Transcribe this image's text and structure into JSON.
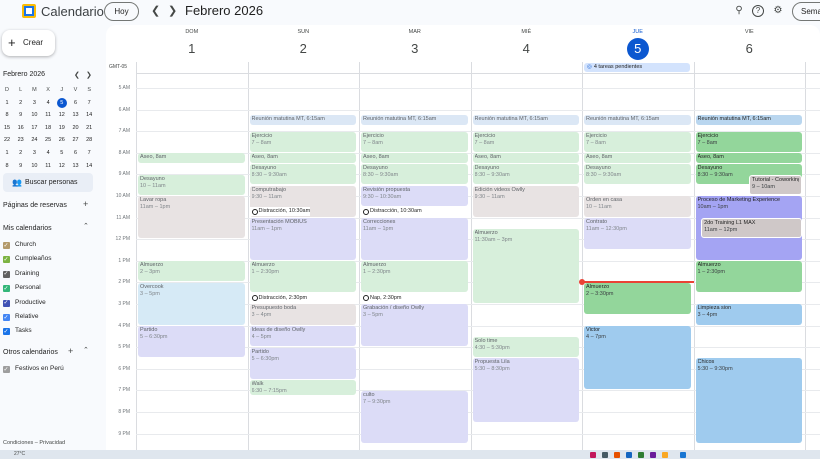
{
  "app": {
    "title": "Calendario",
    "period": "Febrero 2026",
    "today_label": "Hoy",
    "view_label": "Semana"
  },
  "sidebar": {
    "create_label": "Crear",
    "mini_month": "Febrero 2026",
    "mini_headers": [
      "D",
      "L",
      "M",
      "X",
      "J",
      "V",
      "S"
    ],
    "mini_weeks": [
      [
        "1",
        "2",
        "3",
        "4",
        "5",
        "6",
        "7"
      ],
      [
        "8",
        "9",
        "10",
        "11",
        "12",
        "13",
        "14"
      ],
      [
        "15",
        "16",
        "17",
        "18",
        "19",
        "20",
        "21"
      ],
      [
        "22",
        "23",
        "24",
        "25",
        "26",
        "27",
        "28"
      ],
      [
        "1",
        "2",
        "3",
        "4",
        "5",
        "6",
        "7"
      ],
      [
        "8",
        "9",
        "10",
        "11",
        "12",
        "13",
        "14"
      ]
    ],
    "search_people": "Buscar personas",
    "booking_pages": "Páginas de reservas",
    "my_calendars": "Mis calendarios",
    "calendars": [
      {
        "label": "Church",
        "color": "#b39a6b"
      },
      {
        "label": "Cumpleaños",
        "color": "#7cb342"
      },
      {
        "label": "Draining",
        "color": "#616161"
      },
      {
        "label": "Personal",
        "color": "#33b679"
      },
      {
        "label": "Productive",
        "color": "#3f51b5"
      },
      {
        "label": "Relative",
        "color": "#4285f4"
      },
      {
        "label": "Tasks",
        "color": "#1a73e8"
      }
    ],
    "other_calendars": "Otros calendarios",
    "other_list": [
      {
        "label": "Festivos en Perú",
        "color": "#9e9e9e"
      }
    ],
    "footer": "Condiciones – Privacidad"
  },
  "week": {
    "timezone": "GMT-05",
    "days": [
      {
        "name": "DOM",
        "num": "1"
      },
      {
        "name": "SUN",
        "num": "2"
      },
      {
        "name": "MAR",
        "num": "3"
      },
      {
        "name": "MIÉ",
        "num": "4"
      },
      {
        "name": "JUE",
        "num": "5",
        "today": true
      },
      {
        "name": "VIE",
        "num": "6"
      }
    ],
    "hours": [
      "5 AM",
      "6 AM",
      "7 AM",
      "8 AM",
      "9 AM",
      "10 AM",
      "11 AM",
      "12 PM",
      "1 PM",
      "2 PM",
      "3 PM",
      "4 PM",
      "5 PM",
      "6 PM",
      "7 PM",
      "8 PM",
      "9 PM"
    ],
    "allday": [
      {
        "day": 4,
        "text": "4 tareas pendientes"
      }
    ],
    "events": [
      {
        "day": 0,
        "start": 8.0,
        "end": 8.5,
        "title": "Aseo, 8am",
        "sub": "",
        "style": "green"
      },
      {
        "day": 0,
        "start": 9.0,
        "end": 10.0,
        "title": "Desayuno",
        "sub": "10 – 11am",
        "style": "green"
      },
      {
        "day": 0,
        "start": 10.0,
        "end": 12.0,
        "title": "Lavar ropa",
        "sub": "11am – 1pm",
        "style": "gray"
      },
      {
        "day": 0,
        "start": 13.0,
        "end": 14.0,
        "title": "Almuerzo",
        "sub": "2 – 3pm",
        "style": "green"
      },
      {
        "day": 0,
        "start": 14.0,
        "end": 16.0,
        "title": "Overcook",
        "sub": "3 – 5pm",
        "style": "lblue"
      },
      {
        "day": 0,
        "start": 16.0,
        "end": 17.5,
        "title": "Partido",
        "sub": "5 – 6:30pm",
        "style": "purple"
      },
      {
        "day": 1,
        "start": 6.25,
        "end": 6.75,
        "title": "Reunión matutina MT, 6:15am",
        "sub": "",
        "style": "blue"
      },
      {
        "day": 1,
        "start": 7.0,
        "end": 8.0,
        "title": "Ejercicio",
        "sub": "7 – 8am",
        "style": "green"
      },
      {
        "day": 1,
        "start": 8.0,
        "end": 8.5,
        "title": "Aseo, 8am",
        "sub": "",
        "style": "green"
      },
      {
        "day": 1,
        "start": 8.5,
        "end": 9.5,
        "title": "Desayuno",
        "sub": "8:30 – 9:30am",
        "style": "green"
      },
      {
        "day": 1,
        "start": 9.5,
        "end": 11.0,
        "title": "Computrabajo",
        "sub": "9:30 – 11am",
        "style": "gray"
      },
      {
        "day": 1,
        "start": 11.0,
        "end": 13.0,
        "title": "Presentación MOBIUS",
        "sub": "11am – 1pm",
        "style": "purple"
      },
      {
        "day": 1,
        "start": 13.0,
        "end": 14.5,
        "title": "Almuerzo",
        "sub": "1 – 2:30pm",
        "style": "green"
      },
      {
        "day": 1,
        "start": 15.0,
        "end": 16.0,
        "title": "Presupuesto boda",
        "sub": "3 – 4pm",
        "style": "gray"
      },
      {
        "day": 1,
        "start": 16.0,
        "end": 17.0,
        "title": "Ideas de diseño Owlly",
        "sub": "4 – 5pm",
        "style": "purple"
      },
      {
        "day": 1,
        "start": 17.0,
        "end": 18.5,
        "title": "Partido",
        "sub": "5 – 6:30pm",
        "style": "purple"
      },
      {
        "day": 1,
        "start": 18.5,
        "end": 19.25,
        "title": "Walk",
        "sub": "6:30 – 7:15pm",
        "style": "green"
      },
      {
        "day": 2,
        "start": 6.25,
        "end": 6.75,
        "title": "Reunión matutina MT, 6:15am",
        "sub": "",
        "style": "blue"
      },
      {
        "day": 2,
        "start": 7.0,
        "end": 8.0,
        "title": "Ejercicio",
        "sub": "7 – 8am",
        "style": "green"
      },
      {
        "day": 2,
        "start": 8.0,
        "end": 8.5,
        "title": "Aseo, 8am",
        "sub": "",
        "style": "green"
      },
      {
        "day": 2,
        "start": 8.5,
        "end": 9.5,
        "title": "Desayuno",
        "sub": "8:30 – 9:30am",
        "style": "green"
      },
      {
        "day": 2,
        "start": 9.5,
        "end": 10.5,
        "title": "Revisión propuesta",
        "sub": "9:30 – 10:30am",
        "style": "purple"
      },
      {
        "day": 2,
        "start": 11.0,
        "end": 13.0,
        "title": "Correcciones",
        "sub": "11am – 1pm",
        "style": "purple"
      },
      {
        "day": 2,
        "start": 13.0,
        "end": 14.5,
        "title": "Almuerzo",
        "sub": "1 – 2:30pm",
        "style": "green"
      },
      {
        "day": 2,
        "start": 15.0,
        "end": 17.0,
        "title": "Grabación / diseño Owlly",
        "sub": "3 – 5pm",
        "style": "purple"
      },
      {
        "day": 2,
        "start": 19.0,
        "end": 21.5,
        "title": "culto",
        "sub": "7 – 9:30pm",
        "style": "purple"
      },
      {
        "day": 3,
        "start": 6.25,
        "end": 6.75,
        "title": "Reunión matutina MT, 6:15am",
        "sub": "",
        "style": "blue"
      },
      {
        "day": 3,
        "start": 7.0,
        "end": 8.0,
        "title": "Ejercicio",
        "sub": "7 – 8am",
        "style": "green"
      },
      {
        "day": 3,
        "start": 8.0,
        "end": 8.5,
        "title": "Aseo, 8am",
        "sub": "",
        "style": "green"
      },
      {
        "day": 3,
        "start": 8.5,
        "end": 9.5,
        "title": "Desayuno",
        "sub": "8:30 – 9:30am",
        "style": "green"
      },
      {
        "day": 3,
        "start": 9.5,
        "end": 11.0,
        "title": "Edición videos Owlly",
        "sub": "9:30 – 11am",
        "style": "gray"
      },
      {
        "day": 3,
        "start": 11.5,
        "end": 15.0,
        "title": "Almuerzo",
        "sub": "11:30am – 3pm",
        "style": "green"
      },
      {
        "day": 3,
        "start": 16.5,
        "end": 17.5,
        "title": "Solo time",
        "sub": "4:30 – 5:30pm",
        "style": "green"
      },
      {
        "day": 3,
        "start": 17.5,
        "end": 20.5,
        "title": "Propuesta Lila",
        "sub": "5:30 – 8:30pm",
        "style": "purple"
      },
      {
        "day": 4,
        "start": 6.25,
        "end": 6.75,
        "title": "Reunión matutina MT, 6:15am",
        "sub": "",
        "style": "blue"
      },
      {
        "day": 4,
        "start": 7.0,
        "end": 8.0,
        "title": "Ejercicio",
        "sub": "7 – 8am",
        "style": "green"
      },
      {
        "day": 4,
        "start": 8.0,
        "end": 8.5,
        "title": "Aseo, 8am",
        "sub": "",
        "style": "green"
      },
      {
        "day": 4,
        "start": 8.5,
        "end": 9.5,
        "title": "Desayuno",
        "sub": "8:30 – 9:30am",
        "style": "green"
      },
      {
        "day": 4,
        "start": 10.0,
        "end": 11.0,
        "title": "Orden en casa",
        "sub": "10 – 11am",
        "style": "gray"
      },
      {
        "day": 4,
        "start": 11.0,
        "end": 12.5,
        "title": "Contrato",
        "sub": "11am – 12:30pm",
        "style": "purple"
      },
      {
        "day": 4,
        "start": 14.0,
        "end": 15.5,
        "title": "Almuerzo",
        "sub": "2 – 3:30pm",
        "style": "sgreen"
      },
      {
        "day": 4,
        "start": 16.0,
        "end": 19.0,
        "title": "Victor",
        "sub": "4 – 7pm",
        "style": "slblue"
      },
      {
        "day": 5,
        "start": 6.25,
        "end": 6.75,
        "title": "Reunión matutina MT, 6:15am",
        "sub": "",
        "style": "sblue"
      },
      {
        "day": 5,
        "start": 7.0,
        "end": 8.0,
        "title": "Ejercicio",
        "sub": "7 – 8am",
        "style": "sgreen"
      },
      {
        "day": 5,
        "start": 8.0,
        "end": 8.5,
        "title": "Aseo, 8am",
        "sub": "",
        "style": "sgreen"
      },
      {
        "day": 5,
        "start": 8.5,
        "end": 9.5,
        "title": "Desayuno",
        "sub": "8:30 – 9:30am",
        "style": "sgreen"
      },
      {
        "day": 5,
        "start": 9.0,
        "end": 10.0,
        "title": "Tutorial - Coworking",
        "sub": "9 – 10am",
        "style": "sgray",
        "offset": 0.48
      },
      {
        "day": 5,
        "start": 10.0,
        "end": 13.0,
        "title": "Proceso de Marketing Experience",
        "sub": "10am – 1pm",
        "style": "spurple"
      },
      {
        "day": 5,
        "start": 11.0,
        "end": 12.0,
        "title": "2do Training L1 MAX",
        "sub": "11am – 12pm",
        "style": "sgray",
        "offset": 0.05
      },
      {
        "day": 5,
        "start": 13.0,
        "end": 14.5,
        "title": "Almuerzo",
        "sub": "1 – 2:30pm",
        "style": "sgreen"
      },
      {
        "day": 5,
        "start": 15.0,
        "end": 16.0,
        "title": "Limpieza sion",
        "sub": "3 – 4pm",
        "style": "slblue"
      },
      {
        "day": 5,
        "start": 17.5,
        "end": 21.5,
        "title": "Chicos",
        "sub": "5:30 – 9:30pm",
        "style": "slblue"
      }
    ],
    "tasks": [
      {
        "day": 1,
        "start": 10.5,
        "text": "Distracción, 10:30am"
      },
      {
        "day": 1,
        "start": 14.5,
        "text": "Distracción, 2:30pm"
      },
      {
        "day": 2,
        "start": 10.5,
        "text": "Distracción, 10:30am"
      },
      {
        "day": 2,
        "start": 14.5,
        "text": "Nap, 2:30pm"
      }
    ],
    "now": {
      "day": 4,
      "time": 14.0
    }
  },
  "taskbar": {
    "text": "27°C"
  }
}
